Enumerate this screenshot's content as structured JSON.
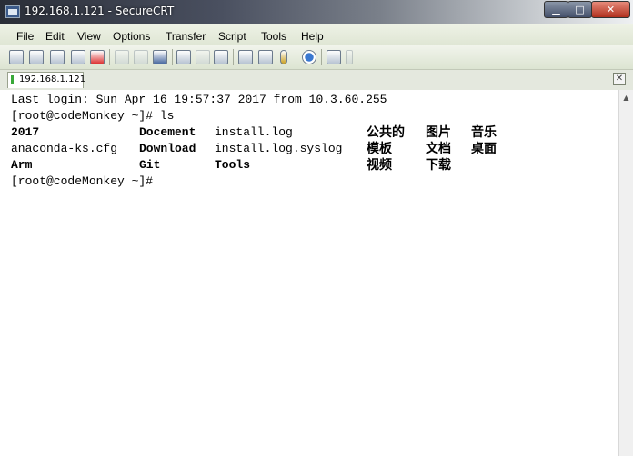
{
  "window": {
    "title": "192.168.1.121 - SecureCRT",
    "min_glyph": "▁",
    "max_glyph": "□",
    "close_glyph": "✕"
  },
  "menu": [
    "File",
    "Edit",
    "View",
    "Options",
    "Transfer",
    "Script",
    "Tools",
    "Help"
  ],
  "tabs": [
    {
      "label": "192.168.1.121"
    }
  ],
  "tab_close_glyph": "✕",
  "terminal": {
    "login_line": "Last login: Sun Apr 16 19:57:37 2017 from 10.3.60.255",
    "prompt1": "[root@codeMonkey ~]# ls",
    "rows": [
      [
        "2017",
        "Docement",
        "install.log",
        "公共的",
        "图片",
        "音乐"
      ],
      [
        "anaconda-ks.cfg",
        "Download",
        "install.log.syslog",
        "模板",
        "文档",
        "桌面"
      ],
      [
        "Arm",
        "Git",
        "Tools",
        "视频",
        "下载",
        ""
      ]
    ],
    "prompt2": "[root@codeMonkey ~]# "
  },
  "scroll_up_glyph": "▲",
  "colors": {
    "terminal_bg": "#ffffff",
    "text": "#000000",
    "tab_marker": "#38a838"
  }
}
